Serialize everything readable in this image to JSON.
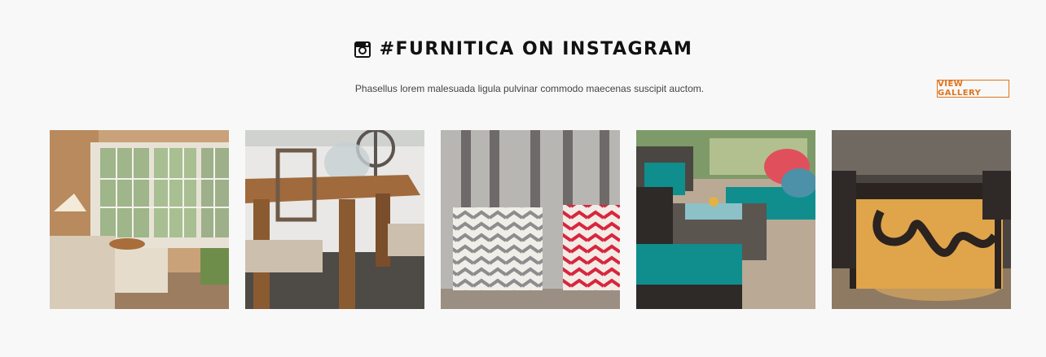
{
  "header": {
    "icon": "instagram-icon",
    "title": "#FURNITICA ON INSTAGRAM",
    "subtitle": "Phasellus lorem malesuada ligula pulvinar commodo maecenas suscipit auctom.",
    "view_gallery_label": "VIEW GALLERY"
  },
  "colors": {
    "accent": "#e0731c",
    "background": "#f8f8f8"
  },
  "gallery": {
    "items": [
      {
        "name": "living-room-photo"
      },
      {
        "name": "wooden-dining-table-photo"
      },
      {
        "name": "chevron-pillows-photo"
      },
      {
        "name": "teal-patio-furniture-photo"
      },
      {
        "name": "illuminated-table-photo"
      }
    ]
  }
}
